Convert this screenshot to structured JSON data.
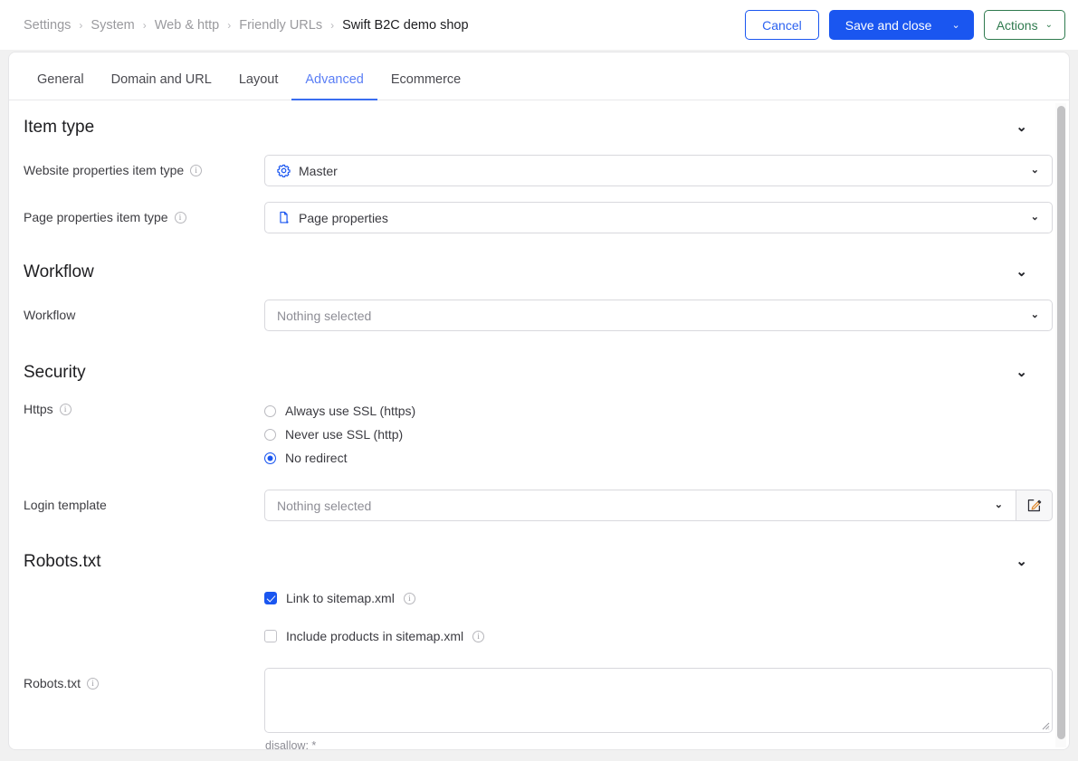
{
  "breadcrumb": {
    "items": [
      {
        "label": "Settings",
        "current": false
      },
      {
        "label": "System",
        "current": false
      },
      {
        "label": "Web & http",
        "current": false
      },
      {
        "label": "Friendly URLs",
        "current": false
      },
      {
        "label": "Swift B2C demo shop",
        "current": true
      }
    ],
    "separator": "›"
  },
  "toolbar": {
    "cancel_label": "Cancel",
    "save_label": "Save and close",
    "save_chevron": "⌄",
    "actions_label": "Actions",
    "actions_chevron": "⌄"
  },
  "tabs": [
    {
      "label": "General",
      "active": false
    },
    {
      "label": "Domain and URL",
      "active": false
    },
    {
      "label": "Layout",
      "active": false
    },
    {
      "label": "Advanced",
      "active": true
    },
    {
      "label": "Ecommerce",
      "active": false
    }
  ],
  "info_glyph": "i",
  "chevron_down": "⌄",
  "sections": {
    "item_type": {
      "title": "Item type",
      "website_item_type": {
        "label": "Website properties item type",
        "value": "Master",
        "icon": "gear-icon"
      },
      "page_item_type": {
        "label": "Page properties item type",
        "value": "Page properties",
        "icon": "page-document-icon"
      }
    },
    "workflow": {
      "title": "Workflow",
      "field_label": "Workflow",
      "value": "Nothing selected"
    },
    "security": {
      "title": "Security",
      "https_label": "Https",
      "https_options": [
        {
          "label": "Always use SSL (https)",
          "selected": false
        },
        {
          "label": "Never use SSL (http)",
          "selected": false
        },
        {
          "label": "No redirect",
          "selected": true
        }
      ],
      "login_template_label": "Login template",
      "login_template_value": "Nothing selected",
      "edit_button_icon": "edit-pencil-icon"
    },
    "robots": {
      "title": "Robots.txt",
      "link_sitemap": {
        "label": "Link to sitemap.xml",
        "checked": true
      },
      "include_products": {
        "label": "Include products in sitemap.xml",
        "checked": false
      },
      "robots_label": "Robots.txt",
      "robots_value": "",
      "robots_help": "disallow: *"
    }
  },
  "colors": {
    "primary": "#1a56f0",
    "accent_green": "#2f7a4e",
    "tab_active": "#5a7ef5"
  }
}
